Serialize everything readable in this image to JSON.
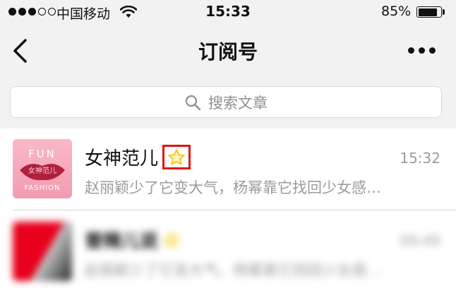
{
  "status_bar": {
    "carrier": "中国移动",
    "time": "15:33",
    "battery_percent": "85%",
    "battery_level": 0.85,
    "signal_bars_filled": 3,
    "signal_bars_total": 5
  },
  "nav": {
    "title": "订阅号"
  },
  "search": {
    "placeholder": "搜索文章"
  },
  "items": [
    {
      "name": "女神范儿",
      "time": "15:32",
      "summary": "赵丽颖少了它变大气，杨幂靠它找回少女感…",
      "avatar_text_top": "FUN",
      "avatar_text_mid": "女神范儿",
      "avatar_text_bottom": "FASHION",
      "starred": true,
      "highlighted": true
    },
    {
      "name": "普辣儿说",
      "time": "09:49",
      "summary": "赵丽颖少了它变大气，杨幂靠它找回少女感…",
      "starred": true,
      "blurred": true
    }
  ],
  "colors": {
    "star": "#f5c518",
    "highlight_box": "#e61212",
    "secondary_text": "#9b9b9b",
    "background": "#f2f2f2"
  }
}
